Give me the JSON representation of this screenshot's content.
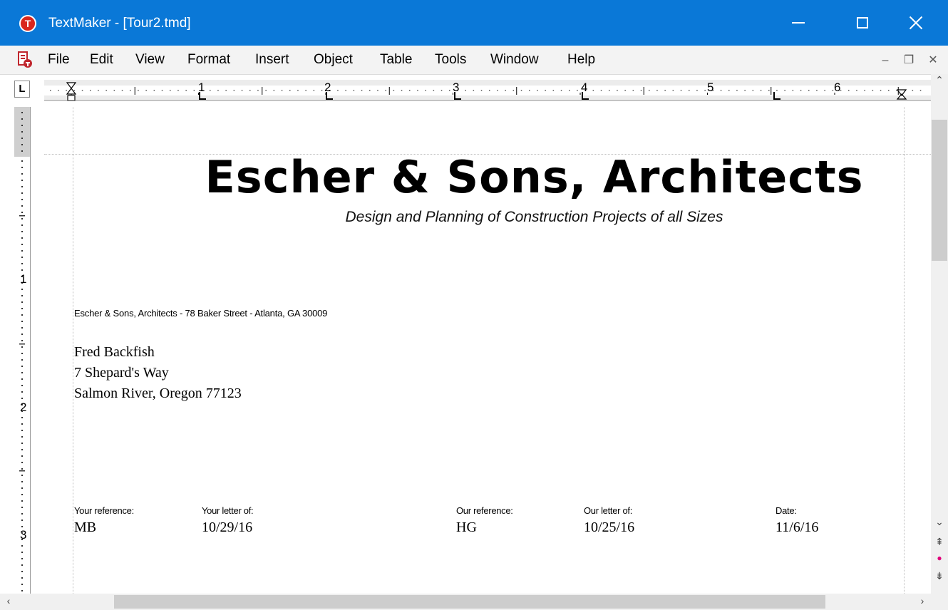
{
  "window": {
    "title": "TextMaker - [Tour2.tmd]",
    "logo_letter": "T",
    "accent_color": "#0a78d7"
  },
  "menu": {
    "items": [
      "File",
      "Edit",
      "View",
      "Format",
      "Insert",
      "Object",
      "Table",
      "Tools",
      "Window",
      "Help"
    ]
  },
  "ruler": {
    "corner_label": "L",
    "h_numbers": [
      "1",
      "2",
      "3",
      "4",
      "5",
      "6"
    ],
    "v_numbers": [
      "1",
      "2",
      "3"
    ]
  },
  "document": {
    "company_name": "Escher & Sons, Architects",
    "tagline": "Design and Planning of Construction Projects of all Sizes",
    "sender_line": "Escher & Sons, Architects - 78 Baker Street - Atlanta, GA 30009",
    "recipient": {
      "name": "Fred Backfish",
      "street": "7 Shepard's Way",
      "city": "Salmon River, Oregon 77123"
    },
    "references": [
      {
        "label": "Your reference:",
        "value": "MB"
      },
      {
        "label": "Your letter of:",
        "value": "10/29/16"
      },
      {
        "label": "Our reference:",
        "value": "HG"
      },
      {
        "label": "Our letter of:",
        "value": "10/25/16"
      },
      {
        "label": "Date:",
        "value": "11/6/16"
      }
    ]
  }
}
